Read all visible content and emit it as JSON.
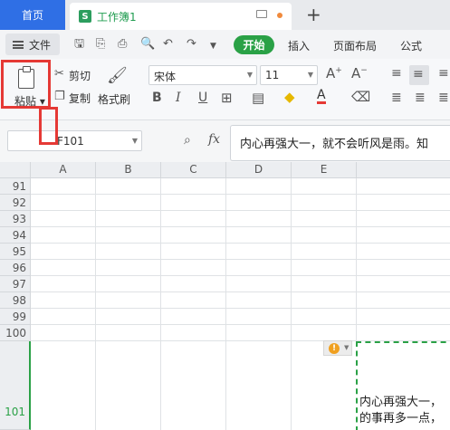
{
  "tabs": {
    "home": "首页",
    "document": "工作簿1",
    "doc_logo": "S"
  },
  "menu": {
    "file": "文件",
    "start": "开始",
    "items": [
      "插入",
      "页面布局",
      "公式"
    ]
  },
  "ribbon": {
    "paste": "粘贴",
    "cut": "剪切",
    "copy": "复制",
    "format_painter": "格式刷",
    "font_name": "宋体",
    "font_size": "11",
    "bold": "B",
    "italic": "I",
    "underline": "U",
    "font_grow": "A⁺",
    "font_shrink": "A⁻"
  },
  "formula_bar": {
    "cell_ref": "F101",
    "fx": "fx",
    "content": "内心再强大一，就不会听风是雨。知"
  },
  "sheet": {
    "columns": [
      "A",
      "B",
      "C",
      "D",
      "E"
    ],
    "rows": [
      "91",
      "92",
      "93",
      "94",
      "95",
      "96",
      "97",
      "98",
      "99",
      "100",
      "101"
    ],
    "cell_line1": "内心再强大一，",
    "cell_line2": "的事再多一点，"
  },
  "colors": {
    "accent_green": "#2aa146",
    "home_tab_blue": "#2f6fe5",
    "highlight_red": "#e53935"
  }
}
